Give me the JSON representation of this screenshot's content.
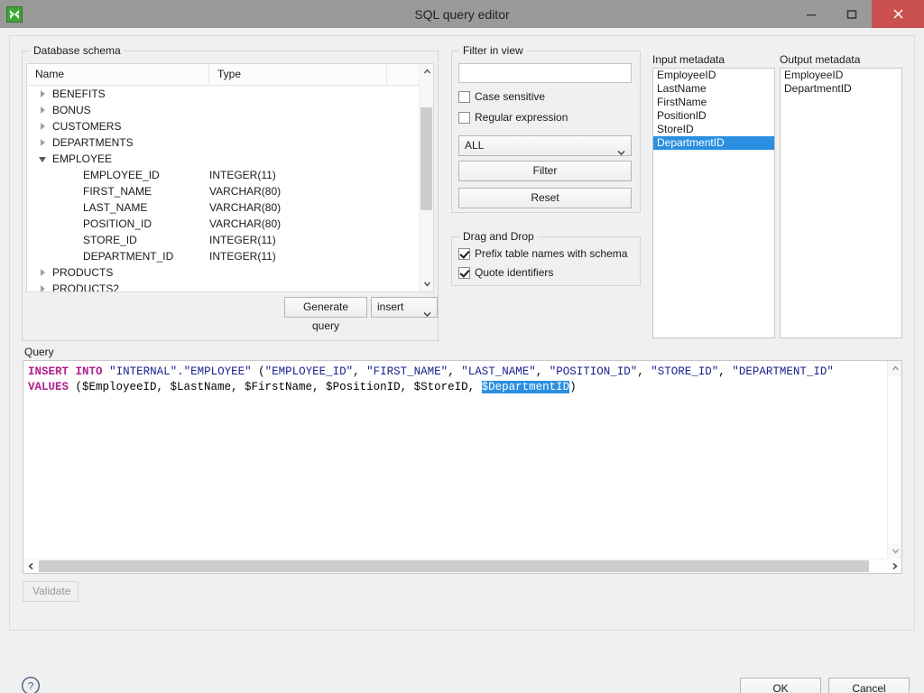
{
  "window": {
    "title": "SQL query editor",
    "app_icon": "clover-icon",
    "controls": {
      "minimize": "minimize-icon",
      "maximize": "maximize-icon",
      "close": "close-icon",
      "close_color": "#cb5050"
    }
  },
  "schema": {
    "group_title": "Database schema",
    "columns": [
      "Name",
      "Type",
      ""
    ],
    "rows": [
      {
        "name": "BENEFITS",
        "type": "",
        "level": 0,
        "state": "collapsed"
      },
      {
        "name": "BONUS",
        "type": "",
        "level": 0,
        "state": "collapsed"
      },
      {
        "name": "CUSTOMERS",
        "type": "",
        "level": 0,
        "state": "collapsed"
      },
      {
        "name": "DEPARTMENTS",
        "type": "",
        "level": 0,
        "state": "collapsed"
      },
      {
        "name": "EMPLOYEE",
        "type": "",
        "level": 0,
        "state": "expanded"
      },
      {
        "name": "EMPLOYEE_ID",
        "type": "INTEGER(11)",
        "level": 1,
        "state": "leaf"
      },
      {
        "name": "FIRST_NAME",
        "type": "VARCHAR(80)",
        "level": 1,
        "state": "leaf"
      },
      {
        "name": "LAST_NAME",
        "type": "VARCHAR(80)",
        "level": 1,
        "state": "leaf"
      },
      {
        "name": "POSITION_ID",
        "type": "VARCHAR(80)",
        "level": 1,
        "state": "leaf"
      },
      {
        "name": "STORE_ID",
        "type": "INTEGER(11)",
        "level": 1,
        "state": "leaf"
      },
      {
        "name": "DEPARTMENT_ID",
        "type": "INTEGER(11)",
        "level": 1,
        "state": "leaf"
      },
      {
        "name": "PRODUCTS",
        "type": "",
        "level": 0,
        "state": "collapsed"
      },
      {
        "name": "PRODUCTS2",
        "type": "",
        "level": 0,
        "state": "collapsed"
      }
    ],
    "generate_button": "Generate query",
    "generate_mode": "insert"
  },
  "filter": {
    "group_title": "Filter in view",
    "input_value": "",
    "case_sensitive": {
      "label": "Case sensitive",
      "checked": false
    },
    "regular_expression": {
      "label": "Regular expression",
      "checked": false
    },
    "scope": "ALL",
    "filter_button": "Filter",
    "reset_button": "Reset"
  },
  "drag_and_drop": {
    "group_title": "Drag and Drop",
    "prefix_schema": {
      "label": "Prefix table names with schema",
      "checked": true
    },
    "quote_identifiers": {
      "label": "Quote identifiers",
      "checked": true
    }
  },
  "input_metadata": {
    "label": "Input metadata",
    "items": [
      "EmployeeID",
      "LastName",
      "FirstName",
      "PositionID",
      "StoreID",
      "DepartmentID"
    ],
    "selected": "DepartmentID",
    "selection_color": "#2a8fe0"
  },
  "output_metadata": {
    "label": "Output metadata",
    "items": [
      "EmployeeID",
      "DepartmentID"
    ],
    "selected": null
  },
  "query": {
    "label": "Query",
    "line1": {
      "kw1": "INSERT",
      "kw2": "INTO",
      "target": "\"INTERNAL\".\"EMPLOYEE\"",
      "columns": "(\"EMPLOYEE_ID\", \"FIRST_NAME\", \"LAST_NAME\", \"POSITION_ID\", \"STORE_ID\", \"DEPARTMENT_ID\""
    },
    "line2": {
      "kw": "VALUES",
      "before": "($EmployeeID, $LastName, $FirstName, $PositionID, $StoreID, ",
      "highlighted": "$DepartmentID",
      "after": ")"
    },
    "keyword_color": "#b02090",
    "string_color": "#18228c",
    "validate_button": "Validate",
    "validate_disabled": true
  },
  "footer": {
    "help_icon": "help-icon",
    "ok_button": "OK",
    "cancel_button": "Cancel"
  }
}
